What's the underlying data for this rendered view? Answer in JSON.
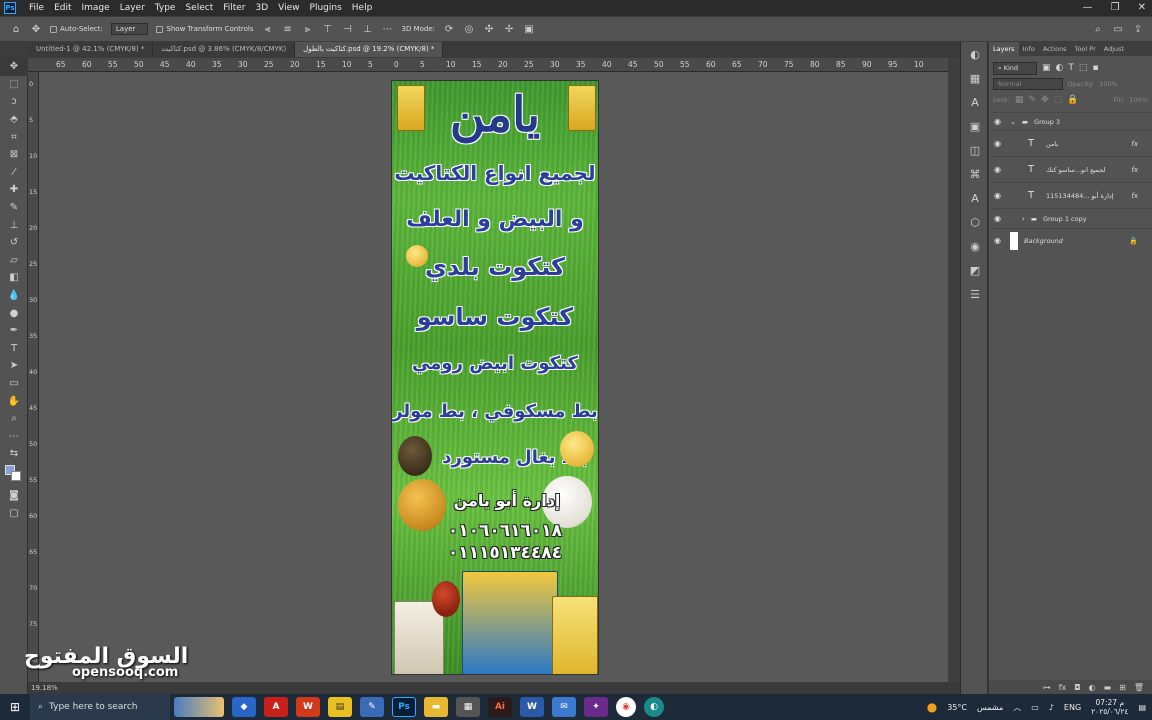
{
  "menubar": {
    "logo": "Ps",
    "items": [
      "File",
      "Edit",
      "Image",
      "Layer",
      "Type",
      "Select",
      "Filter",
      "3D",
      "View",
      "Plugins",
      "Help"
    ]
  },
  "options": {
    "auto_select_label": "Auto-Select:",
    "auto_select_value": "Layer",
    "show_transform_label": "Show Transform Controls",
    "mode_3d_label": "3D Mode:"
  },
  "tabs": [
    {
      "label": "Untitled-1 @ 42.1% (CMYK/8) *"
    },
    {
      "label": "كتاكيت.psd @ 3.86% (CMYK/8/CMYK)"
    },
    {
      "label": "كتاكيت بالطول.psd @ 19.2% (CMYK/8) *"
    }
  ],
  "ruler_top": [
    "65",
    "60",
    "55",
    "50",
    "45",
    "40",
    "35",
    "30",
    "25",
    "20",
    "15",
    "10",
    "5",
    "0",
    "5",
    "10",
    "15",
    "20",
    "25",
    "30",
    "35",
    "40",
    "45",
    "50",
    "55",
    "60",
    "65",
    "70",
    "75",
    "80",
    "85",
    "90",
    "95",
    "10"
  ],
  "ruler_left": [
    "0",
    "5",
    "10",
    "15",
    "20",
    "25",
    "30",
    "35",
    "40",
    "45",
    "50",
    "55",
    "60",
    "65",
    "70",
    "75",
    "80"
  ],
  "artwork": {
    "title": "يامن",
    "line1": "لجميع انواع الكتاكيت",
    "line2": "و البيض و العلف",
    "line3": "كتكوت بلدي",
    "line4": "كتكوت ساسو",
    "line5": "كتكوت ابيض رومي",
    "line6": "بط مسكوفي ، بط مولر",
    "line7": "بط بغال مستورد",
    "manager": "إدارة أبو يامن",
    "phone1": "٠١٠٦٠٦١٦٠١٨",
    "phone2": "٠١١١٥١٣٤٤٨٤"
  },
  "layers_panel": {
    "tabs": [
      "Layers",
      "Info",
      "Actions",
      "Tool Pr",
      "Adjust"
    ],
    "filter_kind": "Kind",
    "blend_mode": "Normal",
    "opacity_label": "Opacity:",
    "opacity_value": "100%",
    "lock_label": "Lock:",
    "fill_label": "Fill:",
    "fill_value": "100%",
    "layers": [
      {
        "name": "Group 3",
        "type": "group"
      },
      {
        "name": "يامن",
        "type": "text"
      },
      {
        "name": "لجميع انو...ساسو كتك",
        "type": "text"
      },
      {
        "name": "إدارة أبو ...115134484",
        "type": "text"
      },
      {
        "name": "Group 1 copy",
        "type": "group"
      },
      {
        "name": "Background",
        "type": "background"
      }
    ],
    "fx_label": "fx"
  },
  "status": {
    "zoom": "19.18%"
  },
  "watermark": {
    "arabic": "السوق المفتوح",
    "english": "opensooq.com"
  },
  "taskbar": {
    "search_placeholder": "Type here to search",
    "temperature": "35°C",
    "weather_label": "مشمس",
    "language": "ENG",
    "time": "07:27 م",
    "date": "٢٠٢٥/٠٦/٢٤"
  }
}
